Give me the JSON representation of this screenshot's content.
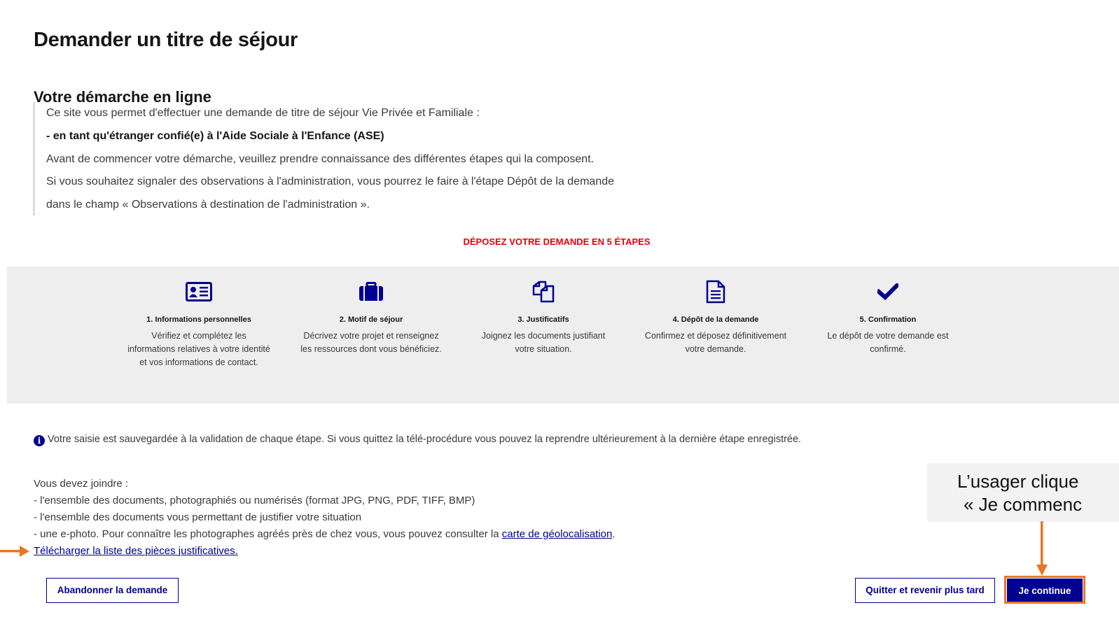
{
  "page": {
    "title": "Demander un titre de séjour",
    "subtitle": "Votre démarche en ligne"
  },
  "intro": {
    "lines": [
      "Ce site vous permet d'effectuer une demande de titre de séjour Vie Privée et Familiale :",
      "- en tant qu'étranger confié(e) à l'Aide Sociale à l'Enfance (ASE)",
      "Avant de commencer votre démarche, veuillez prendre connaissance des différentes étapes qui la composent.",
      "Si vous souhaitez signaler des observations à l'administration, vous pourrez le faire à l'étape Dépôt de la demande",
      "dans le champ « Observations à destination de l'administration »."
    ]
  },
  "steps": {
    "heading": "DÉPOSEZ VOTRE DEMANDE EN 5 ÉTAPES",
    "items": [
      {
        "title": "1. Informations personnelles",
        "desc": [
          "Vérifiez et complétez les",
          "informations relatives à votre identité",
          "et vos informations de contact."
        ],
        "icon": "id-card-icon"
      },
      {
        "title": "2. Motif de séjour",
        "desc": [
          "Décrivez votre projet et renseignez",
          "les ressources dont vous bénéficiez."
        ],
        "icon": "briefcase-icon"
      },
      {
        "title": "3. Justificatifs",
        "desc": [
          "Joignez les documents justifiant",
          "votre situation."
        ],
        "icon": "documents-icon"
      },
      {
        "title": "4. Dépôt de la demande",
        "desc": [
          "Confirmez et déposez définitivement",
          "votre demande."
        ],
        "icon": "file-icon"
      },
      {
        "title": "5. Confirmation",
        "desc": [
          "Le dépôt de votre demande est",
          "confirmé."
        ],
        "icon": "checkmark-icon"
      }
    ]
  },
  "info": {
    "text": "Votre saisie est sauvegardée à la validation de chaque étape. Si vous quittez la télé-procédure vous pouvez la reprendre ultérieurement à la dernière étape enregistrée.",
    "icon": "info-icon"
  },
  "docs": {
    "intro": "Vous devez joindre :",
    "line1": "- l'ensemble des documents, photographiés ou numérisés (format JPG, PNG, PDF, TIFF, BMP)",
    "line2": "- l'ensemble des documents vous permettant de justifier votre situation",
    "line3_prefix": "- une e-photo. Pour connaître les photographes agréés près de chez vous, vous pouvez consulter la ",
    "line3_link": "carte de géolocalisation",
    "line3_suffix": ".",
    "download_link": "Télécharger la liste des pièces justificatives."
  },
  "buttons": {
    "abandon": "Abandonner la demande",
    "quit": "Quitter et revenir plus tard",
    "continue": "Je continue"
  },
  "annotation": {
    "line1": "L’usager clique",
    "line2": "« Je commenc",
    "accent": "#e87722"
  },
  "colors": {
    "primary": "#000091",
    "danger": "#e1000f",
    "panel": "#eeeeee"
  }
}
